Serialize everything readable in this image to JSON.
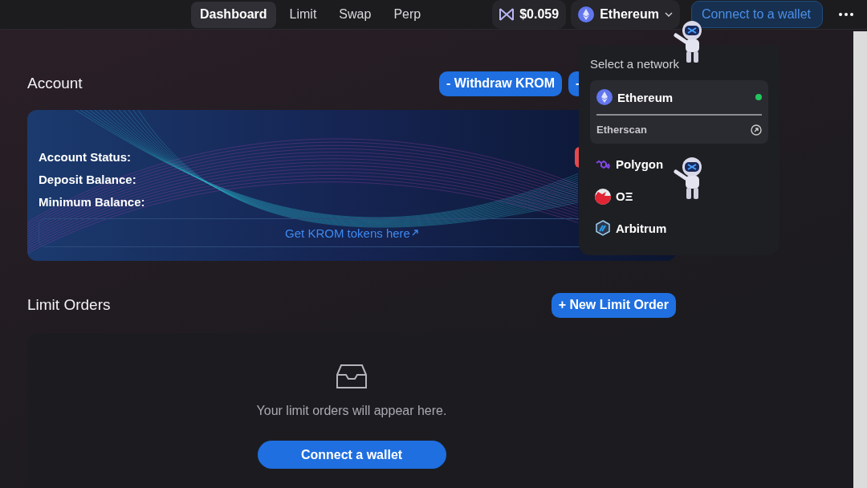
{
  "nav": {
    "tabs": [
      {
        "label": "Dashboard",
        "selected": true
      },
      {
        "label": "Limit",
        "selected": false
      },
      {
        "label": "Swap",
        "selected": false
      },
      {
        "label": "Perp",
        "selected": false
      }
    ],
    "price": "$0.059",
    "network_button": "Ethereum",
    "connect_button": "Connect to a wallet"
  },
  "account": {
    "title": "Account",
    "buttons": [
      "- Withdraw KROM",
      "-"
    ],
    "fields": [
      "Account Status:",
      "Deposit Balance:",
      "Minimum Balance:"
    ],
    "link": "Get KROM tokens here"
  },
  "limit_orders": {
    "title": "Limit Orders",
    "new_button": "+ New Limit Order",
    "empty_text": "Your limit orders will appear here.",
    "connect_button": "Connect a wallet"
  },
  "network_menu": {
    "title": "Select a network",
    "networks": [
      {
        "name": "Ethereum",
        "kind": "ethereum",
        "selected": true,
        "explorer": "Etherscan"
      },
      {
        "name": "Polygon",
        "kind": "polygon",
        "selected": false
      },
      {
        "name": "OΞ",
        "kind": "optimism",
        "selected": false
      },
      {
        "name": "Arbitrum",
        "kind": "arbitrum",
        "selected": false
      }
    ]
  }
}
